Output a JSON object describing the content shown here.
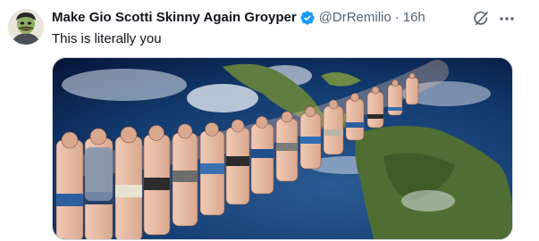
{
  "tweet": {
    "author_name": "Make Gio Scotti Skinny Again Groyper",
    "handle": "@DrRemilio",
    "separator": "·",
    "time": "16h",
    "text": "This is literally you"
  },
  "icons": {
    "verified": "verified-badge-icon",
    "grok": "grok-icon",
    "more": "more-options-icon"
  },
  "colors": {
    "verified": "#1d9bf0",
    "secondary_text": "#536471",
    "primary_text": "#0f1419"
  }
}
